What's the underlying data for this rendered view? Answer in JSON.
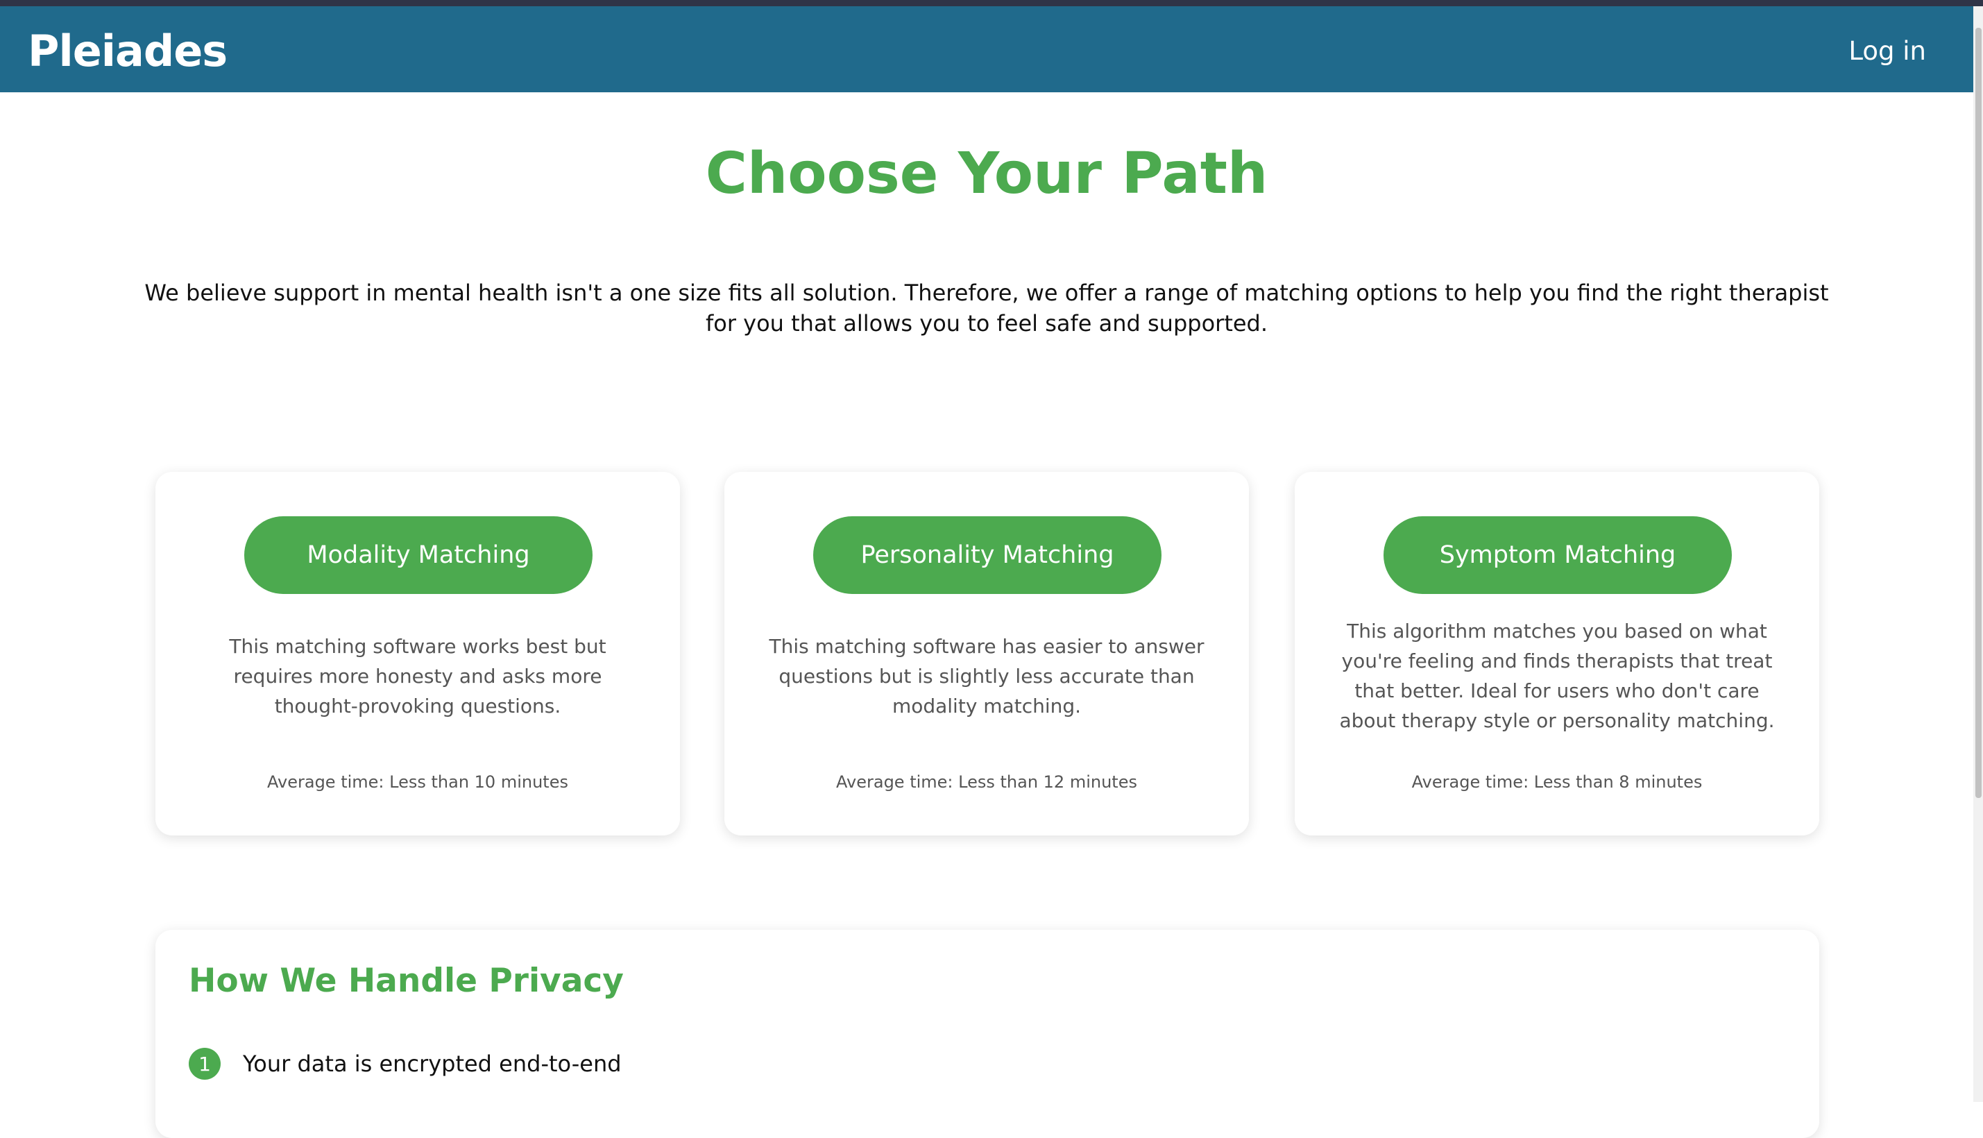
{
  "header": {
    "brand": "Pleiades",
    "login_label": "Log in",
    "bg_color": "#206a8c"
  },
  "main": {
    "title": "Choose Your Path",
    "intro": "We believe support in mental health isn't a one size fits all solution. Therefore, we offer a range of matching options to help you find the right therapist for you that allows you to feel safe and supported.",
    "accent_color": "#4caa4f",
    "cards": [
      {
        "button_label": "Modality Matching",
        "description": "This matching software works best but requires more honesty and asks more thought-provoking questions.",
        "time": "Average time: Less than 10 minutes"
      },
      {
        "button_label": "Personality Matching",
        "description": "This matching software has easier to answer questions but is slightly less accurate than modality matching.",
        "time": "Average time: Less than 12 minutes"
      },
      {
        "button_label": "Symptom Matching",
        "description": "This algorithm matches you based on what you're feeling and finds therapists that treat that better. Ideal for users who don't care about therapy style or personality matching.",
        "time": "Average time: Less than 8 minutes"
      }
    ]
  },
  "privacy": {
    "title": "How We Handle Privacy",
    "items": [
      {
        "number": "1",
        "text": "Your data is encrypted end-to-end"
      }
    ]
  }
}
